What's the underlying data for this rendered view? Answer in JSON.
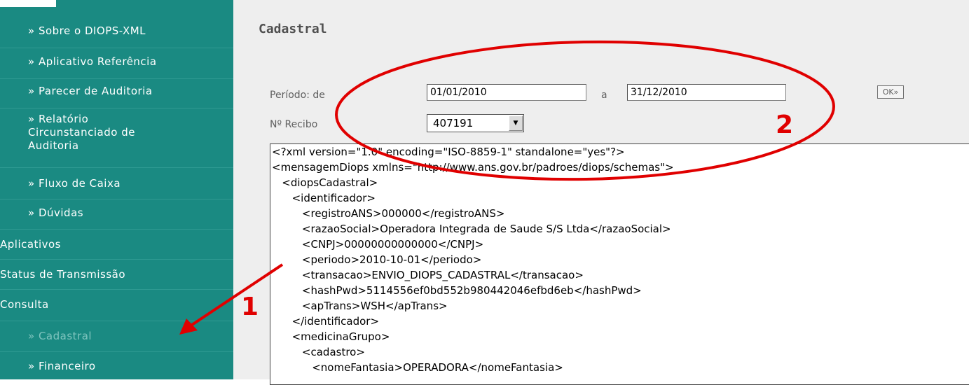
{
  "sidebar": {
    "items": [
      {
        "label": "» Sobre o DIOPS-XML",
        "type": "sub"
      },
      {
        "label": "» Aplicativo Referência",
        "type": "sub"
      },
      {
        "label": "» Parecer de Auditoria",
        "type": "sub"
      },
      {
        "label_lines": [
          "» Relatório",
          "Circunstanciado de",
          "Auditoria"
        ],
        "type": "sub"
      },
      {
        "label": "» Fluxo de Caixa",
        "type": "sub"
      },
      {
        "label": "» Dúvidas",
        "type": "sub"
      },
      {
        "label": "Aplicativos",
        "type": "top"
      },
      {
        "label": "Status de Transmissão",
        "type": "top"
      },
      {
        "label": "Consulta",
        "type": "top"
      },
      {
        "label": "» Cadastral",
        "type": "sub",
        "active": true
      },
      {
        "label": "» Financeiro",
        "type": "sub"
      }
    ]
  },
  "main": {
    "title": "Cadastral",
    "periodo_label": "Período: de",
    "date_from": "01/01/2010",
    "a_label": "a",
    "date_to": "31/12/2010",
    "ok_label": "OK»",
    "recibo_label": "Nº Recibo",
    "recibo_value": "407191",
    "select_arrow_icon": "dropdown-arrow-icon",
    "xml_lines": [
      "<?xml version=\"1.0\" encoding=\"ISO-8859-1\" standalone=\"yes\"?>",
      "<mensagemDiops xmlns=\"http://www.ans.gov.br/padroes/diops/schemas\">",
      "   <diopsCadastral>",
      "      <identificador>",
      "         <registroANS>000000</registroANS>",
      "         <razaoSocial>Operadora Integrada de Saude S/S Ltda</razaoSocial>",
      "         <CNPJ>00000000000000</CNPJ>",
      "         <periodo>2010-10-01</periodo>",
      "         <transacao>ENVIO_DIOPS_CADASTRAL</transacao>",
      "         <hashPwd>5114556ef0bd552b980442046efbd6eb</hashPwd>",
      "         <apTrans>WSH</apTrans>",
      "      </identificador>",
      "      <medicinaGrupo>",
      "         <cadastro>",
      "            <nomeFantasia>OPERADORA</nomeFantasia>"
    ]
  },
  "annotations": {
    "marker_1": "1",
    "marker_2": "2",
    "color": "#e00000"
  },
  "colors": {
    "sidebar_bg": "#1a8a82",
    "main_bg": "#eeeeee",
    "active_item": "#7fc4be"
  }
}
